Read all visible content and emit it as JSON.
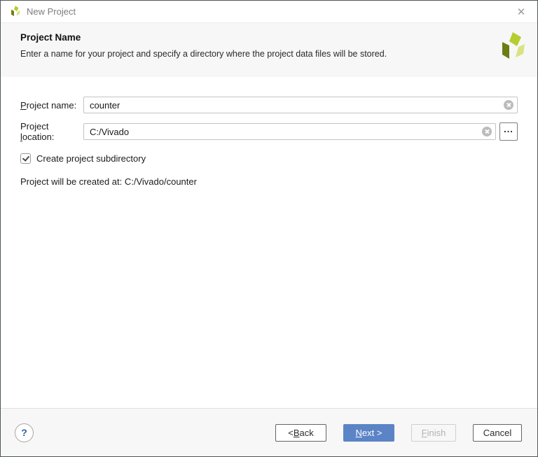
{
  "window": {
    "title": "New Project"
  },
  "header": {
    "title": "Project Name",
    "description": "Enter a name for your project and specify a directory where the project data files will be stored."
  },
  "form": {
    "name_label": {
      "pre": "",
      "mnemonic": "P",
      "post": "roject name:"
    },
    "name_value": "counter",
    "location_label": {
      "pre": "Project ",
      "mnemonic": "l",
      "post": "ocation:"
    },
    "location_value": "C:/Vivado",
    "browse_label": "...",
    "subdir_checkbox_label": "Create project subdirectory",
    "subdir_checkbox_checked": "true",
    "created_at_text": "Project will be created at: C:/Vivado/counter"
  },
  "footer": {
    "help_label": "?",
    "back": {
      "pre": "< ",
      "mnemonic": "B",
      "post": "ack"
    },
    "next": {
      "pre": "",
      "mnemonic": "N",
      "post": "ext >"
    },
    "finish": {
      "pre": "",
      "mnemonic": "F",
      "post": "inish"
    },
    "cancel_label": "Cancel"
  },
  "icons": {
    "titlebar_logo": "vivado-logo",
    "close": "close-x-icon",
    "clear_field": "clear-circle-x-icon",
    "browse": "ellipsis-browse",
    "checkbox_mark": "checkmark-icon",
    "help": "question-mark-icon",
    "header_logo": "xilinx-vivado-logo"
  },
  "colors": {
    "accent_blue": "#5b84c6",
    "logo_dark": "#6e7c15",
    "logo_mid": "#b7cc2e",
    "logo_light": "#d9e382",
    "dialog_border": "#4e565a",
    "band_gray": "#f7f7f7"
  }
}
